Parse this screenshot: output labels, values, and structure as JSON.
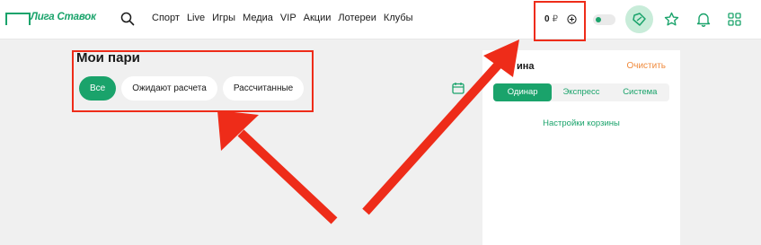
{
  "header": {
    "logo_text": "Лига Ставок",
    "nav": [
      "Спорт",
      "Live",
      "Игры",
      "Медиа",
      "VIP",
      "Акции",
      "Лотереи",
      "Клубы"
    ],
    "balance_amount": "0",
    "balance_currency": "₽",
    "icons": [
      "search-icon",
      "add-funds-icon",
      "toggle-switch",
      "coupon-icon",
      "star-icon",
      "bell-icon",
      "grid-icon"
    ]
  },
  "page": {
    "title": "Мои пари",
    "filters": [
      {
        "label": "Все",
        "active": true
      },
      {
        "label": "Ожидают расчета",
        "active": false
      },
      {
        "label": "Рассчитанные",
        "active": false
      }
    ]
  },
  "betslip": {
    "title_partial": "ина",
    "clear_label": "Очистить",
    "tabs": [
      "Одинар",
      "Экспресс",
      "Система"
    ],
    "active_tab": "Одинар",
    "settings_link": "Настройки корзины"
  },
  "colors": {
    "brand_green": "#1aa36b",
    "accent_orange": "#f08a3c",
    "annotation_red": "#ee2c19",
    "background": "#f0f0f0"
  }
}
